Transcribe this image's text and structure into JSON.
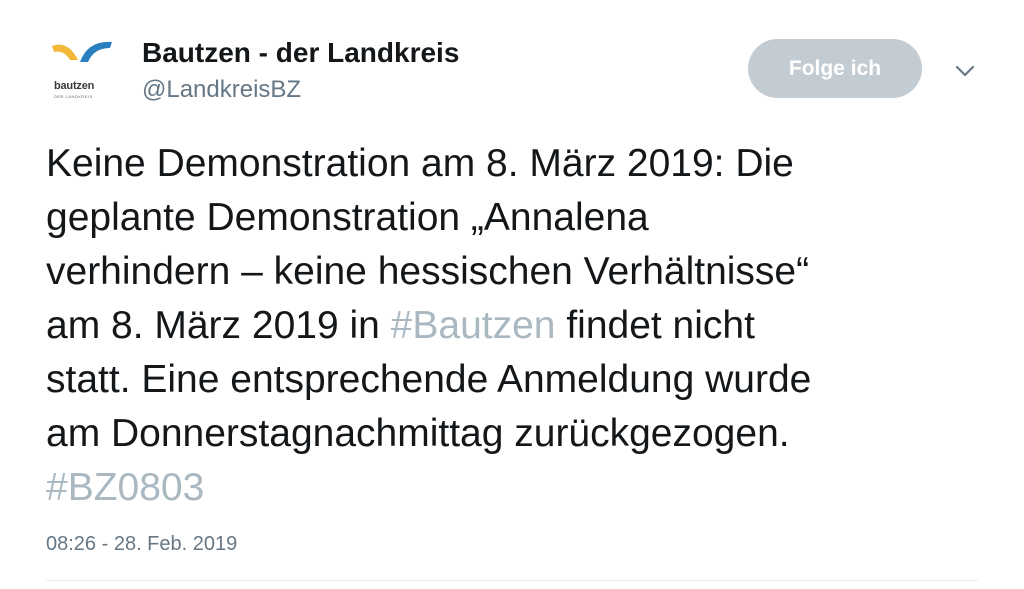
{
  "user": {
    "display_name": "Bautzen - der Landkreis",
    "handle": "@LandkreisBZ",
    "avatar": {
      "icon": "bautzen-logo",
      "word": "bautzen",
      "sub": "DER LANDKREIS",
      "colors": {
        "yellow": "#f2b83a",
        "blue": "#2a7fc1"
      }
    }
  },
  "follow_button": {
    "label": "Folge ich",
    "background": "#c4ccd3"
  },
  "menu_icon": "chevron-down-icon",
  "tweet": {
    "text_1": "Keine Demonstration am 8. März 2019:  Die\ngeplante Demonstration „Annalena\nverhindern – keine hessischen Verhältnisse“\nam 8. März 2019 in ",
    "hashtag_1": "#Bautzen",
    "text_2": " findet nicht\nstatt. Eine entsprechende Anmeldung wurde\nam Donnerstagnachmittag zurückgezogen.\n",
    "hashtag_2": "#BZ0803",
    "hashtag_color": "#aab8c2"
  },
  "timestamp": "08:26 - 28. Feb. 2019"
}
